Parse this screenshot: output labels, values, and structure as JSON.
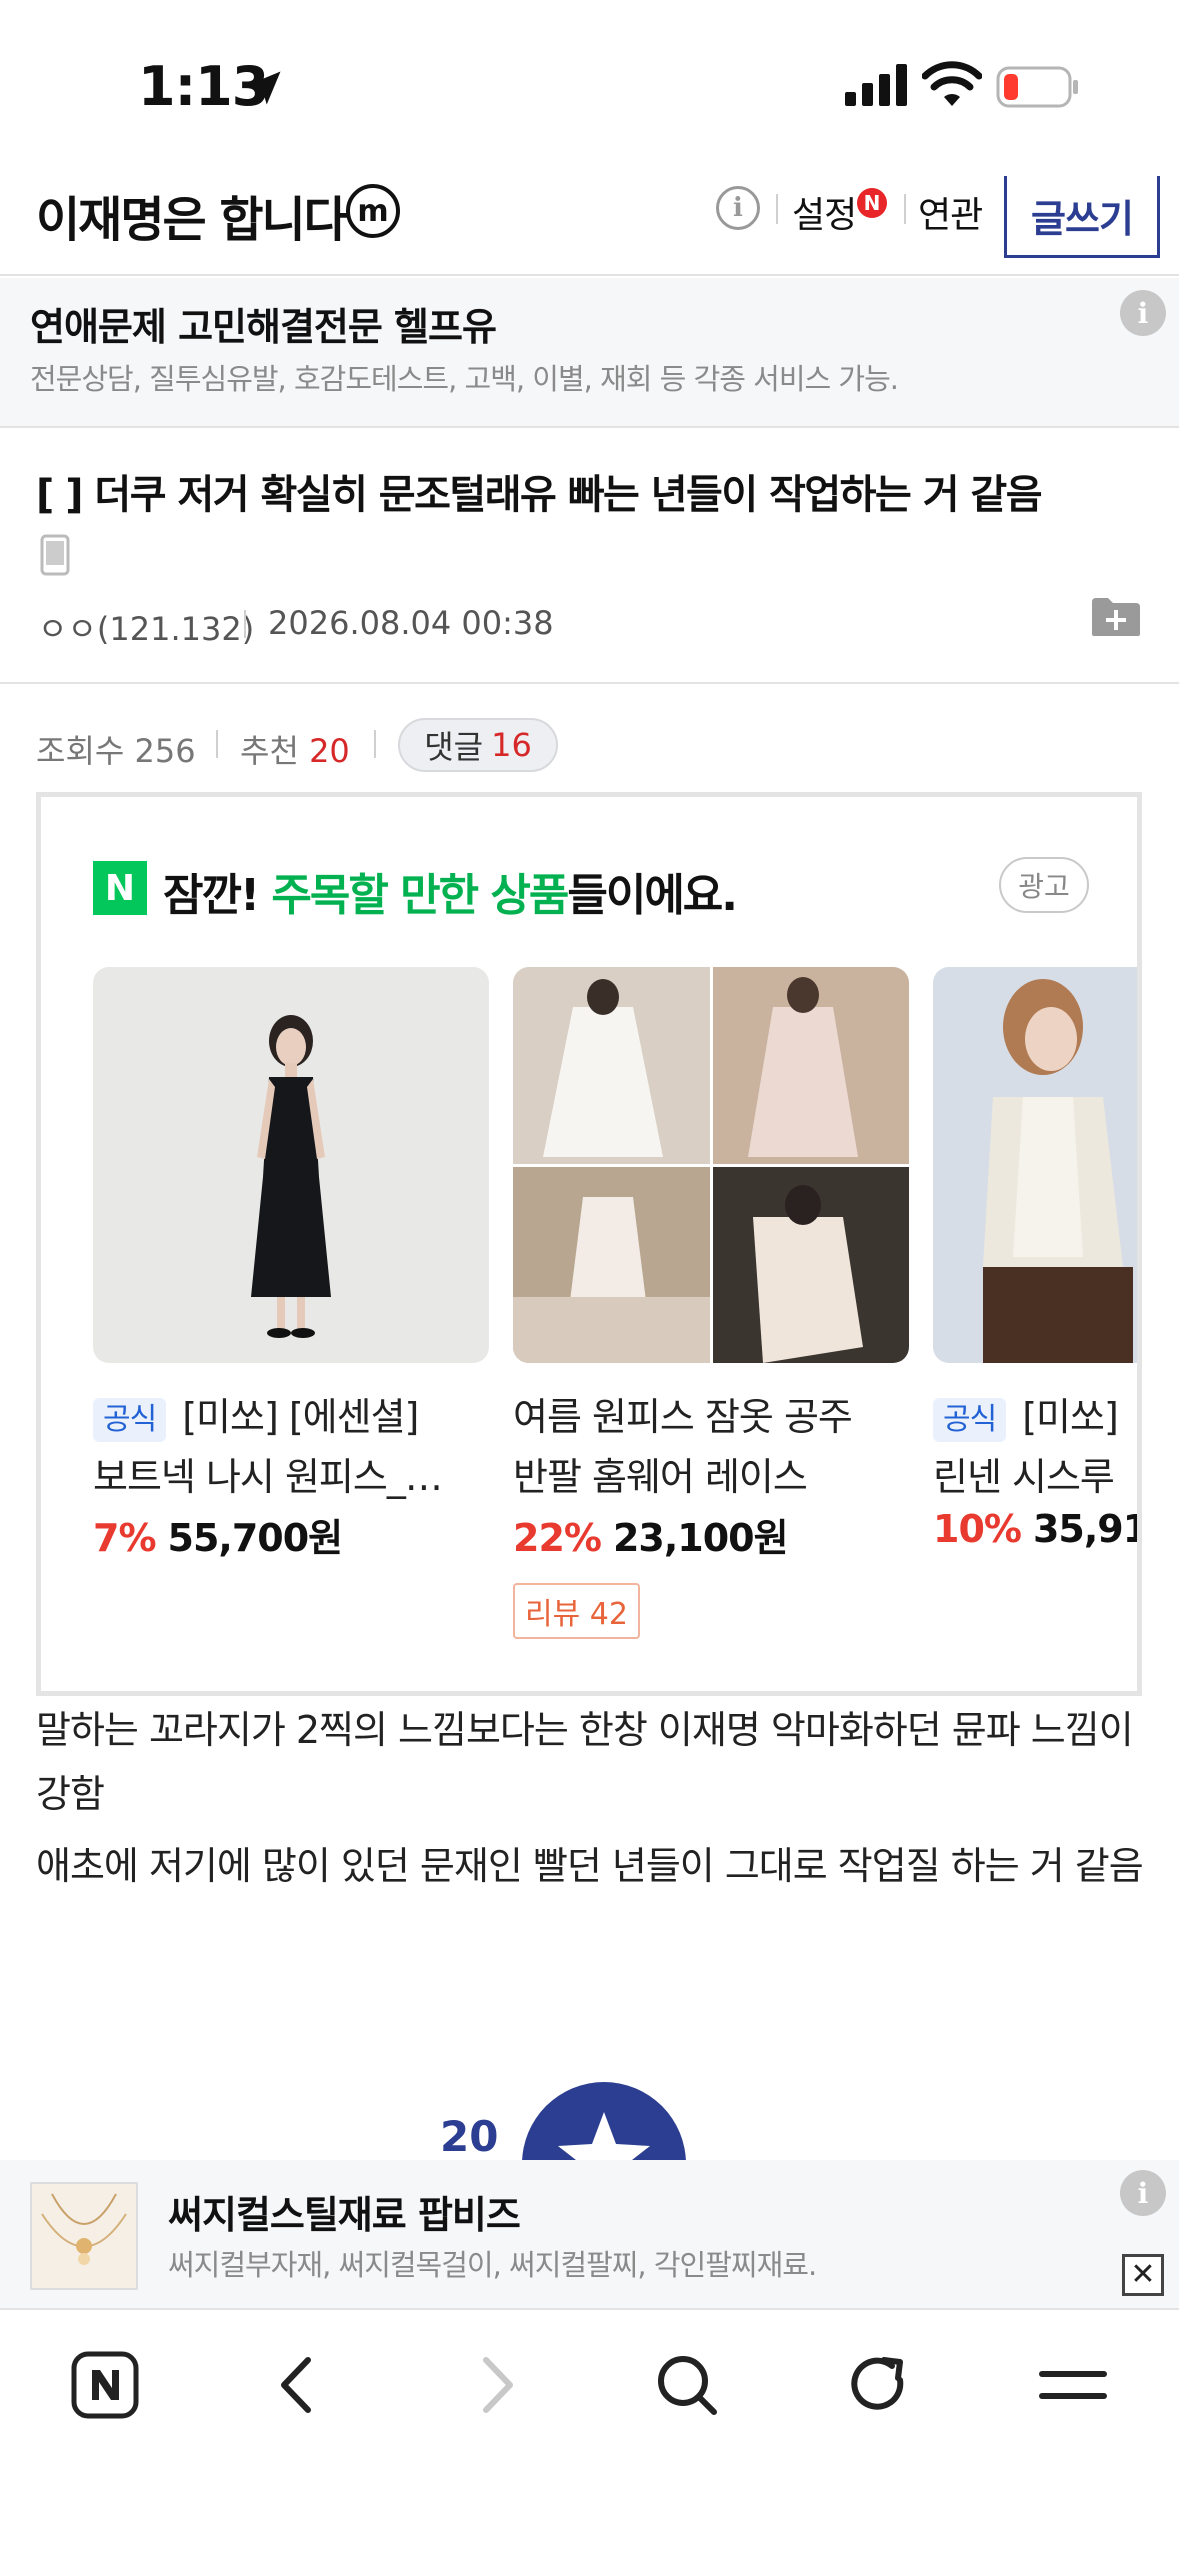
{
  "status_bar": {
    "time": "1:13"
  },
  "header": {
    "gallery_title": "이재명은 합니다",
    "gallery_badge": "m",
    "info_icon_label": "i",
    "settings_label": "설정",
    "settings_badge": "N",
    "related_label": "연관",
    "write_label": "글쓰기"
  },
  "top_ad": {
    "title": "연애문제 고민해결전문 헬프유",
    "description": "전문상담, 질투심유발, 호감도테스트, 고백, 이별, 재회 등 각종 서비스 가능."
  },
  "post": {
    "title": "[  ] 더쿠 저거 확실히 문조털래유 빠는 년들이 작업하는 거 같음",
    "author": "ㅇㅇ(121.132)",
    "date": "2026.08.04 00:38",
    "views_label": "조회수",
    "views": "256",
    "recommend_label": "추천",
    "recommend": "20",
    "comments_label": "댓글",
    "comments": "16",
    "body": [
      "말하는 꼬라지가 2찍의 느낌보다는 한창 이재명 악마화하던 뮨파 느낌이 강함",
      "애초에 저기에 많이 있던 문재인 빨던 년들이 그대로 작업질 하는 거 같음"
    ],
    "recommend_count": "20"
  },
  "product_ad": {
    "logo": "N",
    "headline_pre": "잠깐! ",
    "headline_green": "주목할 만한 상품",
    "headline_post": "들이에요.",
    "ad_label": "광고",
    "products": [
      {
        "badge": "공식",
        "line1": "[미쏘] [에센셜]",
        "line2": "보트넥 나시 원피스_…",
        "discount": "7%",
        "price": "55,700원"
      },
      {
        "badge": "",
        "line1": "여름 원피스 잠옷 공주",
        "line2": "반팔 홈웨어 레이스",
        "discount": "22%",
        "price": "23,100원",
        "review": "리뷰 42"
      },
      {
        "badge": "공식",
        "line1": "[미쏘]",
        "line2": "린넨 시스루",
        "discount": "10%",
        "price": "35,91"
      }
    ]
  },
  "bottom_ad": {
    "title": "써지컬스틸재료 팝비즈",
    "description": "써지컬부자재, 써지컬목걸이, 써지컬팔찌, 각인팔찌재료.",
    "close_label": "✕"
  },
  "colors": {
    "brand_navy": "#2c3e91",
    "naver_green": "#03c75a",
    "discount_red": "#e83a2f"
  }
}
